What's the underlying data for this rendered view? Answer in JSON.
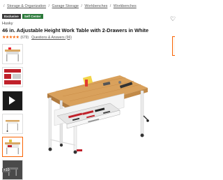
{
  "breadcrumb": {
    "lead": "/",
    "items": [
      "Storage & Organization",
      "Garage Storage",
      "Workbenches",
      "Workbenches"
    ]
  },
  "badges": {
    "exclusive": "Exclusive",
    "self_center": "Self Center"
  },
  "product": {
    "brand": "Husky",
    "title": "46 in. Adjustable Height Work Table with 2-Drawers in White",
    "rating": 4.5,
    "stars": "★★★★★",
    "review_count": "(679)",
    "qa_label": "Questions & Answers (96)"
  },
  "icons": {
    "favorite": "heart-icon",
    "play": "play-icon",
    "star": "star-icon"
  },
  "gallery": {
    "more_label": "+10"
  },
  "colors": {
    "accent": "#f96302",
    "badge_green": "#2c7a3b",
    "badge_dark": "#3a3a3a"
  }
}
